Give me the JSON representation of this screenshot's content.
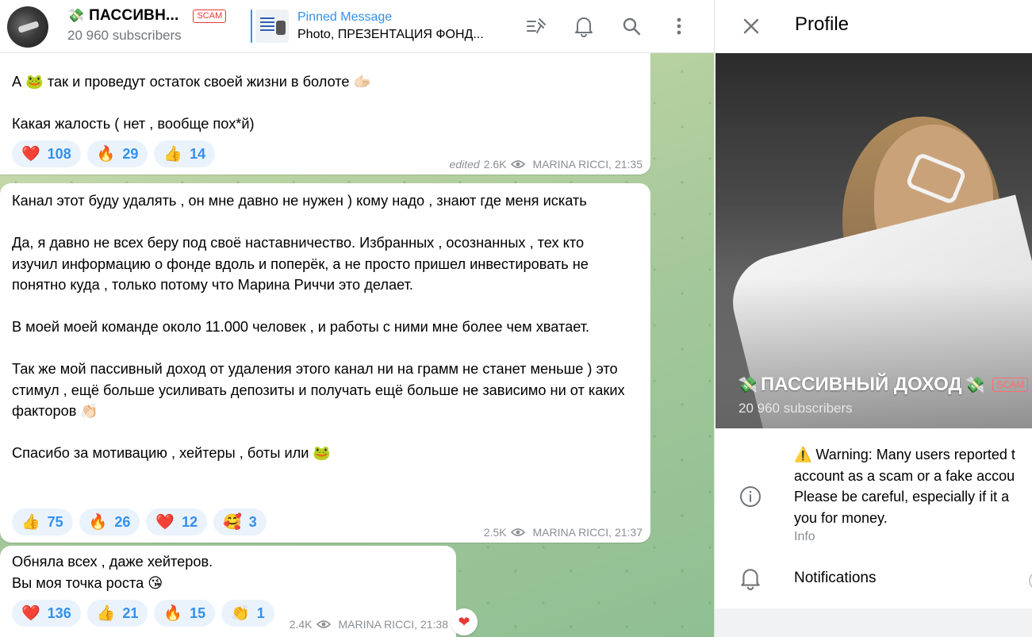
{
  "channel": {
    "title": "ПАССИВН...",
    "title_emoji": "💸",
    "scam_label": "SCAM",
    "subscribers": "20 960 subscribers"
  },
  "pinned": {
    "label": "Pinned Message",
    "preview": "Photo, ПРЕЗЕНТАЦИЯ ФОНД..."
  },
  "toolbar": {
    "icons": [
      "pin-list-icon",
      "bell-icon",
      "search-icon",
      "more-vertical-icon"
    ]
  },
  "messages": [
    {
      "text": "А 🐸 так и проведут остаток своей жизни в болоте 🫱🏻\n\nКакая жалость ( нет , вообще пох*й)",
      "reactions": [
        {
          "emoji": "❤️",
          "count": "108"
        },
        {
          "emoji": "🔥",
          "count": "29"
        },
        {
          "emoji": "👍",
          "count": "14"
        }
      ],
      "edited": "edited",
      "views": "2.6K",
      "author_time": "MARINA RICCI, 21:35"
    },
    {
      "text": "Канал этот буду удалять , он мне давно не нужен ) кому надо , знают где меня искать\n\nДа, я давно не всех беру под своё наставничество. Избранных , осознанных , тех кто изучил информацию о фонде вдоль и поперёк, а не просто пришел инвестировать не понятно куда , только потому что Марина Риччи это делает.\n\nВ моей моей команде около 11.000 человек , и работы с ними мне более чем хватает.\n\nТак же мой пассивный доход от удаления этого канал ни на грамм не станет меньше ) это стимул , ещё больше усиливать депозиты и получать ещё больше не зависимо ни от каких факторов 👏🏻\n\nСпасибо за мотивацию , хейтеры , боты или 🐸",
      "reactions": [
        {
          "emoji": "👍",
          "count": "75"
        },
        {
          "emoji": "🔥",
          "count": "26"
        },
        {
          "emoji": "❤️",
          "count": "12"
        },
        {
          "emoji": "🥰",
          "count": "3"
        }
      ],
      "views": "2.5K",
      "author_time": "MARINA RICCI, 21:37"
    },
    {
      "text": "Обняла всех , даже хейтеров.\nВы моя точка роста 😘",
      "reactions": [
        {
          "emoji": "❤️",
          "count": "136"
        },
        {
          "emoji": "👍",
          "count": "21"
        },
        {
          "emoji": "🔥",
          "count": "15"
        },
        {
          "emoji": "👏",
          "count": "1"
        }
      ],
      "views": "2.4K",
      "author_time": "MARINA RICCI, 21:38",
      "quick_reaction": "❤"
    }
  ],
  "profile": {
    "header_title": "Profile",
    "name": "ПАССИВНЫЙ ДОХОД",
    "name_emoji_left": "💸",
    "name_emoji_right": "💸",
    "scam_label": "SCAM",
    "subscribers": "20 960 subscribers",
    "warning": "⚠️ Warning: Many users reported t\naccount as a scam or a fake accou\nPlease be careful, especially if it a\nyou for money.",
    "info_label": "Info",
    "notifications_label": "Notifications"
  },
  "colors": {
    "accent": "#3390ec",
    "scam": "#e53935",
    "reaction_bg": "#eaf3fc",
    "chat_bg": "#b9d2a1"
  }
}
